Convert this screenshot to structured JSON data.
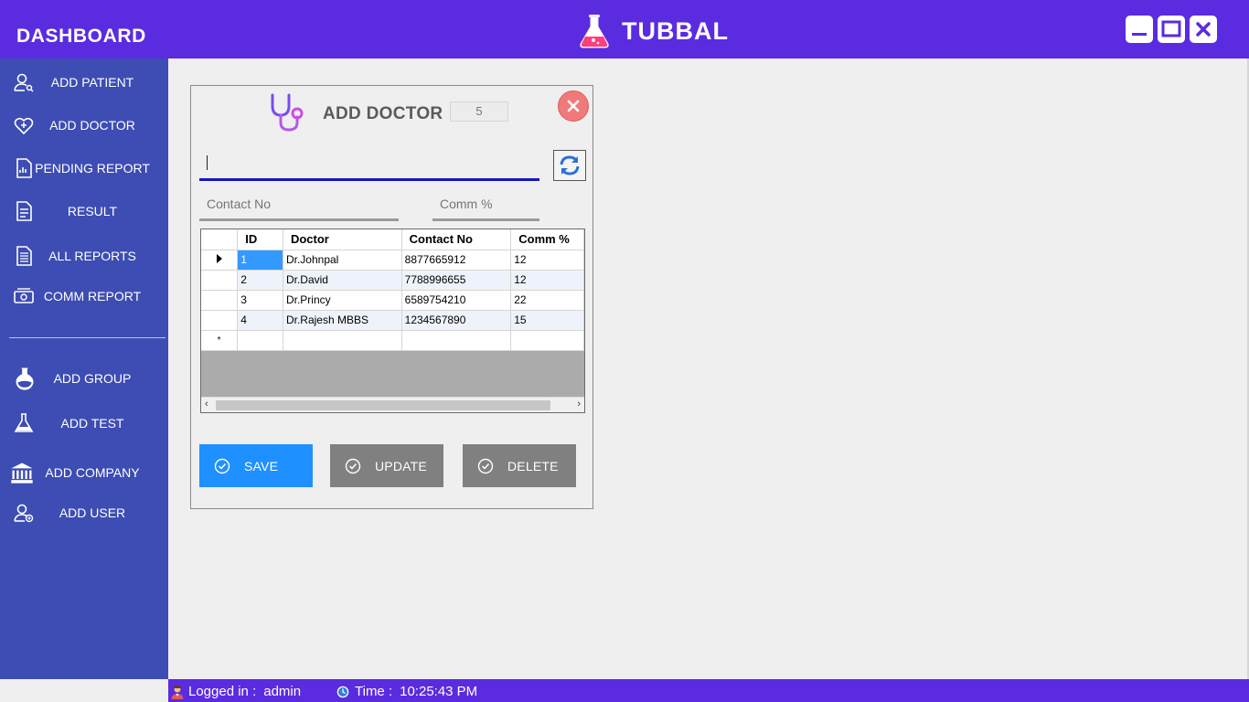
{
  "header": {
    "title": "DASHBOARD",
    "brand": "TUBBAL"
  },
  "colors": {
    "titlebar": "#5b2be0",
    "sidebar": "#3d4db3",
    "save_button": "#1e90ff",
    "secondary_button": "#808080",
    "close_button": "#f07a7a"
  },
  "sidebar": {
    "items": [
      {
        "label": "ADD PATIENT",
        "icon": "user-search-icon"
      },
      {
        "label": "ADD DOCTOR",
        "icon": "heart-plus-icon"
      },
      {
        "label": "PENDING REPORT",
        "icon": "document-chart-icon"
      },
      {
        "label": "RESULT",
        "icon": "document-icon"
      },
      {
        "label": "ALL REPORTS",
        "icon": "documents-icon"
      },
      {
        "label": "COMM REPORT",
        "icon": "money-icon"
      },
      {
        "label": "ADD GROUP",
        "icon": "flask-round-icon"
      },
      {
        "label": "ADD TEST",
        "icon": "flask-icon"
      },
      {
        "label": "ADD COMPANY",
        "icon": "bank-icon"
      },
      {
        "label": "ADD USER",
        "icon": "user-add-icon"
      }
    ]
  },
  "dialog": {
    "title": "ADD DOCTOR",
    "id_value": "5",
    "doctor_name_value": "",
    "contact_placeholder": "Contact No",
    "comm_placeholder": "Comm %",
    "grid": {
      "columns": [
        "ID",
        "Doctor",
        "Contact No",
        "Comm %"
      ],
      "rows": [
        [
          "1",
          "Dr.Johnpal",
          "8877665912",
          "12"
        ],
        [
          "2",
          "Dr.David",
          "7788996655",
          "12"
        ],
        [
          "3",
          "Dr.Princy",
          "6589754210",
          "22"
        ],
        [
          "4",
          "Dr.Rajesh MBBS",
          "1234567890",
          "15"
        ]
      ],
      "new_row_marker": "*"
    },
    "buttons": {
      "save": "SAVE",
      "update": "UPDATE",
      "delete": "DELETE"
    }
  },
  "status": {
    "logged_in_label": "Logged in :",
    "user": "admin",
    "time_label": "Time :",
    "time": "10:25:43 PM"
  }
}
